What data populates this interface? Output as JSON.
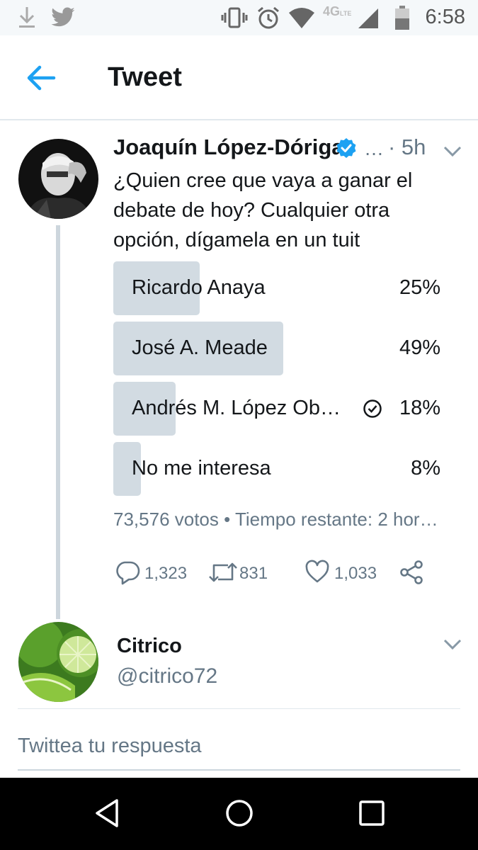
{
  "status_bar": {
    "time": "6:58",
    "network": "4G",
    "network_sub": "LTE"
  },
  "header": {
    "title": "Tweet"
  },
  "tweet": {
    "author": "Joaquín López-Dóriga",
    "truncation": "…",
    "time": "· 5h",
    "text": "¿Quien cree que vaya a ganar el debate de hoy? Cualquier otra opción, dígamela en un tuit",
    "poll": {
      "options": [
        {
          "label": "Ricardo Anaya",
          "percent": "25%",
          "share": 25,
          "chosen": false
        },
        {
          "label": "José A. Meade",
          "percent": "49%",
          "share": 49,
          "chosen": false
        },
        {
          "label": "Andrés M. López Ob…",
          "percent": "18%",
          "share": 18,
          "chosen": true
        },
        {
          "label": "No me interesa",
          "percent": "8%",
          "share": 8,
          "chosen": false
        }
      ],
      "footer": "73,576 votos • Tiempo restante: 2 hor…"
    },
    "actions": {
      "replies": "1,323",
      "retweets": "831",
      "likes": "1,033"
    }
  },
  "reply_user": {
    "name": "Citrico",
    "handle": "@citrico72"
  },
  "reply_box": {
    "placeholder": "Twittea tu respuesta"
  },
  "colors": {
    "accent": "#1da1f2",
    "poll_bar": "#d2dbe2",
    "muted": "#657786"
  }
}
